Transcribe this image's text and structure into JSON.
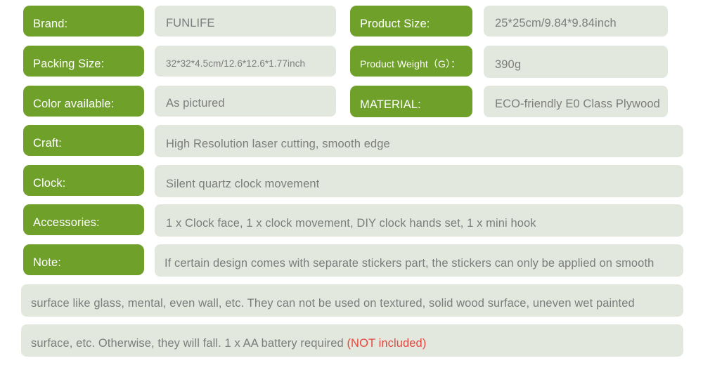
{
  "theme": {
    "label_bg": "#6fa02a",
    "label_text": "#ffffff",
    "value_bg": "#e2e8dd",
    "value_text": "#7d7d7d",
    "alert_text": "#e8473f",
    "page_bg": "#ffffff"
  },
  "spec_table": {
    "rows_two_column": [
      {
        "left_label": "Brand:",
        "left_value": "FUNLIFE",
        "right_label": "Product Size:",
        "right_value": "25*25cm/9.84*9.84inch"
      },
      {
        "left_label": "Packing Size:",
        "left_value": "32*32*4.5cm/12.6*12.6*1.77inch",
        "right_label": "Product Weight（G）：",
        "right_value": "390g"
      },
      {
        "left_label": "Color available:",
        "left_value": "As pictured",
        "right_label": "MATERIAL:",
        "right_value": "ECO-friendly E0 Class Plywood"
      }
    ],
    "rows_full_width": [
      {
        "label": "Craft:",
        "value": "High Resolution laser cutting, smooth edge"
      },
      {
        "label": "Clock:",
        "value": "Silent quartz clock movement"
      },
      {
        "label": "Accessories:",
        "value": "1 x Clock face, 1 x clock movement, DIY clock hands set, 1 x mini hook"
      },
      {
        "label": "Note:",
        "value": "If certain design comes with separate stickers part, the stickers can only be applied on smooth"
      }
    ],
    "note_continuation": [
      {
        "text": "surface like glass, mental, even wall, etc. They can not be used on textured, solid wood surface, uneven wet painted"
      },
      {
        "text_before": "surface,  etc. Otherwise, they will fall.  1 x AA battery required ",
        "text_highlight": "(NOT included)"
      }
    ]
  }
}
